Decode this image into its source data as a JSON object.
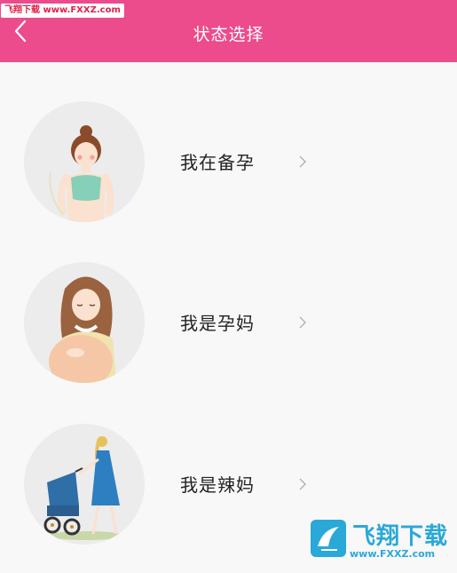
{
  "watermark_top": "飞翔下载 www.FXXZ.com",
  "header": {
    "title": "状态选择",
    "back_icon": "chevron-left-icon",
    "bg_color": "#ec4b8c"
  },
  "items": [
    {
      "label": "我在备孕",
      "image": "fitness-woman-illustration"
    },
    {
      "label": "我是孕妈",
      "image": "pregnant-woman-illustration"
    },
    {
      "label": "我是辣妈",
      "image": "mom-with-stroller-illustration"
    }
  ],
  "watermark": {
    "text": "飞翔下载",
    "url": "www.FXXZ.com"
  }
}
